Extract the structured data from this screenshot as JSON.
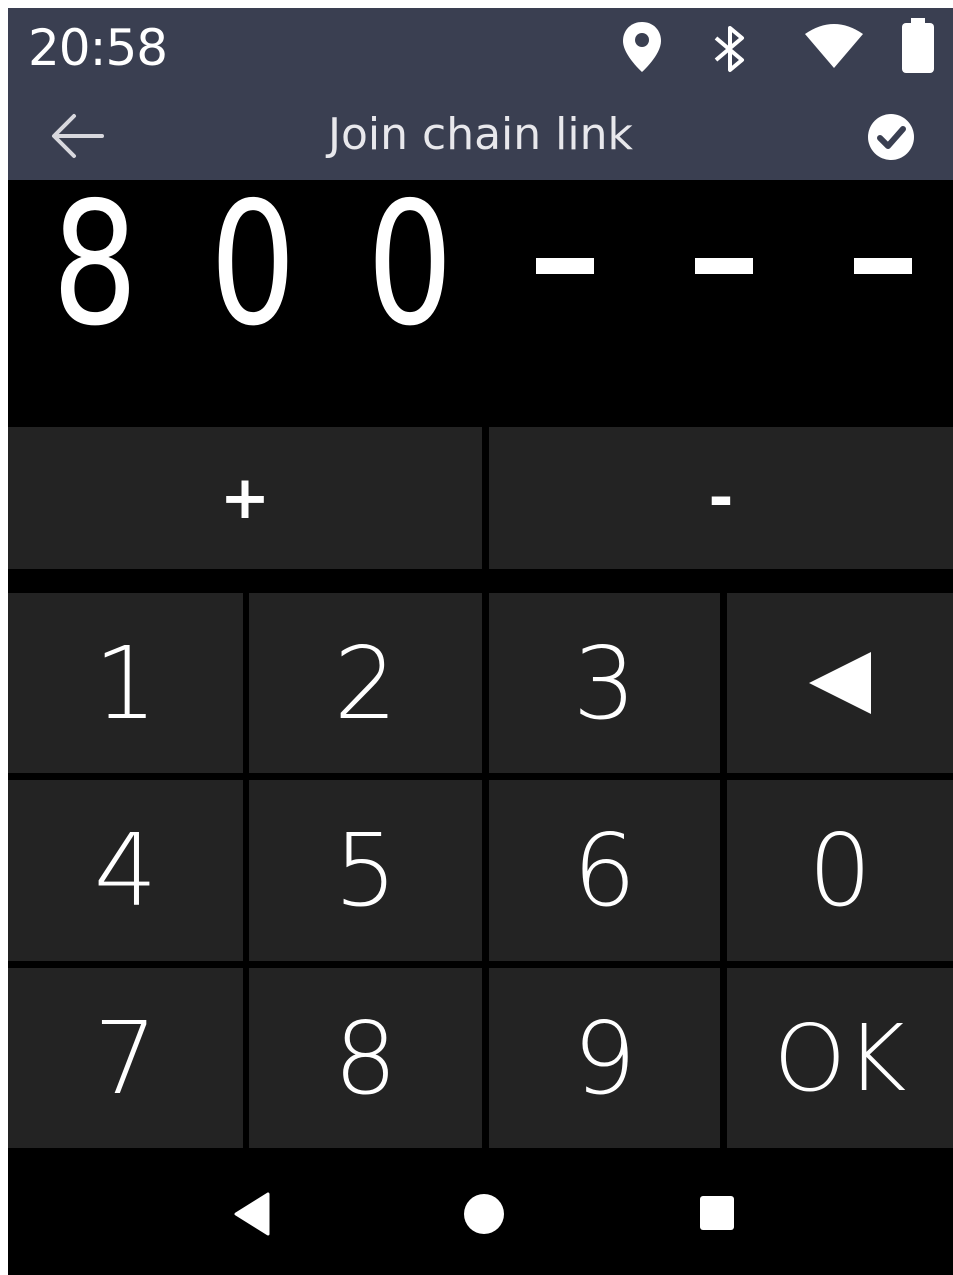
{
  "status_bar": {
    "time": "20:58",
    "icons": [
      "location-icon",
      "bluetooth-icon",
      "wifi-icon",
      "battery-icon"
    ]
  },
  "app_bar": {
    "title": "Join chain link",
    "back_icon": "back-arrow-icon",
    "confirm_icon": "check-circle-icon"
  },
  "display": {
    "digits": [
      "8",
      "0",
      "0"
    ],
    "placeholders": [
      "–",
      "–",
      "–"
    ]
  },
  "sign_keys": {
    "plus": "+",
    "minus": "-"
  },
  "keypad": {
    "rows": [
      [
        "1",
        "2",
        "3",
        "◀"
      ],
      [
        "4",
        "5",
        "6",
        "0"
      ],
      [
        "7",
        "8",
        "9",
        "OK"
      ]
    ]
  },
  "nav_bar": {
    "icons": [
      "nav-back-icon",
      "nav-home-icon",
      "nav-recents-icon"
    ]
  },
  "colors": {
    "bar_background": "#3a3f51",
    "key_background": "#232323",
    "screen_background": "#000000",
    "text": "#ffffff"
  }
}
